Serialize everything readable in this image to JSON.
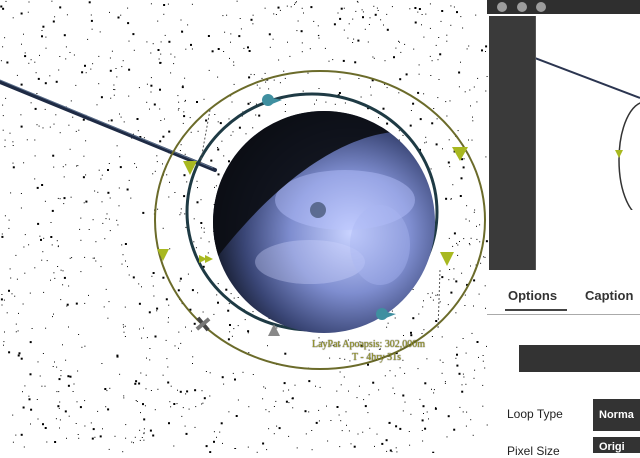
{
  "scene": {
    "orbit_label_line1": "LayPat Apoapsis: 302,000m",
    "orbit_label_line2": "T - 4hry 31s"
  },
  "side_panel": {
    "tabs": [
      {
        "label": "Options",
        "active": true
      },
      {
        "label": "Caption",
        "active": false
      }
    ],
    "rows": [
      {
        "label": "Loop Type",
        "value": "Norma"
      },
      {
        "label": "Pixel Size",
        "value": "Origi"
      }
    ]
  },
  "colors": {
    "orbit_outer": "#6b6b2a",
    "orbit_inner": "#1e3a44",
    "marker": "#a8b820",
    "vessel": "#3f8fa0",
    "planet_light": "#9aa8e8",
    "planet_dark": "#1a2030"
  }
}
